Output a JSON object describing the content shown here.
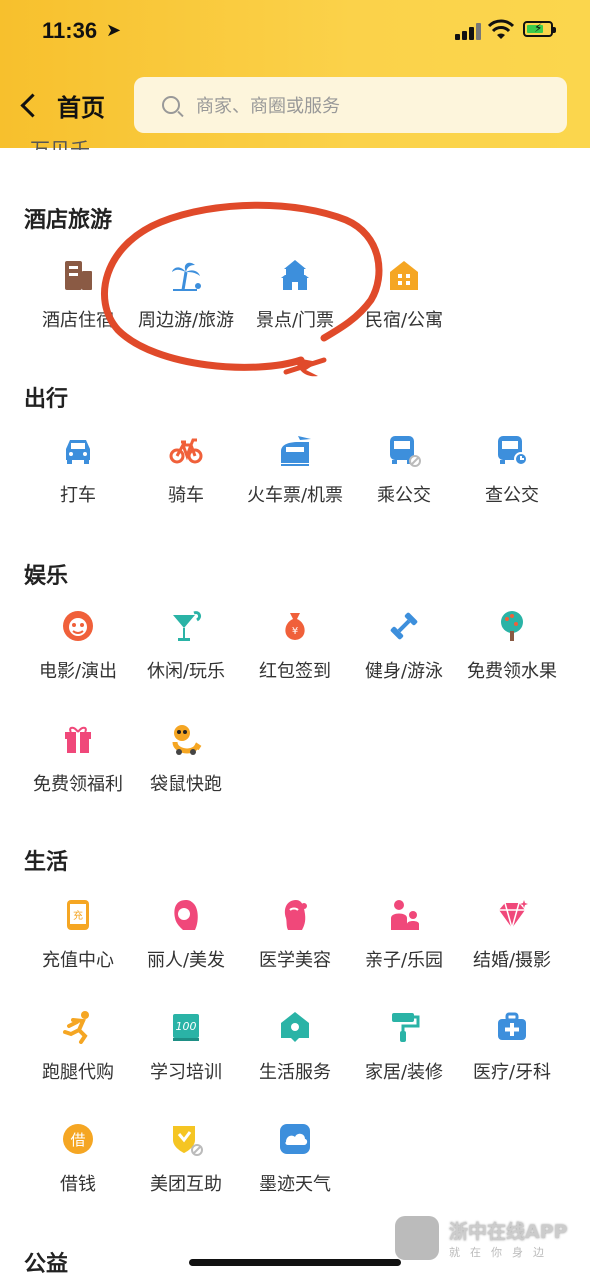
{
  "status": {
    "time": "11:36"
  },
  "header": {
    "back_label": "首页",
    "search_placeholder": "商家、商圈或服务"
  },
  "cutoff_text": "万贝千",
  "sections": {
    "hotel": {
      "title": "酒店旅游",
      "items": [
        "酒店住宿",
        "周边游/旅游",
        "景点/门票",
        "民宿/公寓"
      ]
    },
    "travel": {
      "title": "出行",
      "items": [
        "打车",
        "骑车",
        "火车票/机票",
        "乘公交",
        "查公交"
      ]
    },
    "fun": {
      "title": "娱乐",
      "items": [
        "电影/演出",
        "休闲/玩乐",
        "红包签到",
        "健身/游泳",
        "免费领水果",
        "免费领福利",
        "袋鼠快跑"
      ]
    },
    "life": {
      "title": "生活",
      "items": [
        "充值中心",
        "丽人/美发",
        "医学美容",
        "亲子/乐园",
        "结婚/摄影",
        "跑腿代购",
        "学习培训",
        "生活服务",
        "家居/装修",
        "医疗/牙科",
        "借钱",
        "美团互助",
        "墨迹天气"
      ]
    },
    "charity": {
      "title": "公益"
    }
  },
  "watermark": {
    "main": "浙中在线APP",
    "sub": "就在你身边"
  },
  "colors": {
    "header": "#f9c93c",
    "annotation": "#e04a2a"
  }
}
